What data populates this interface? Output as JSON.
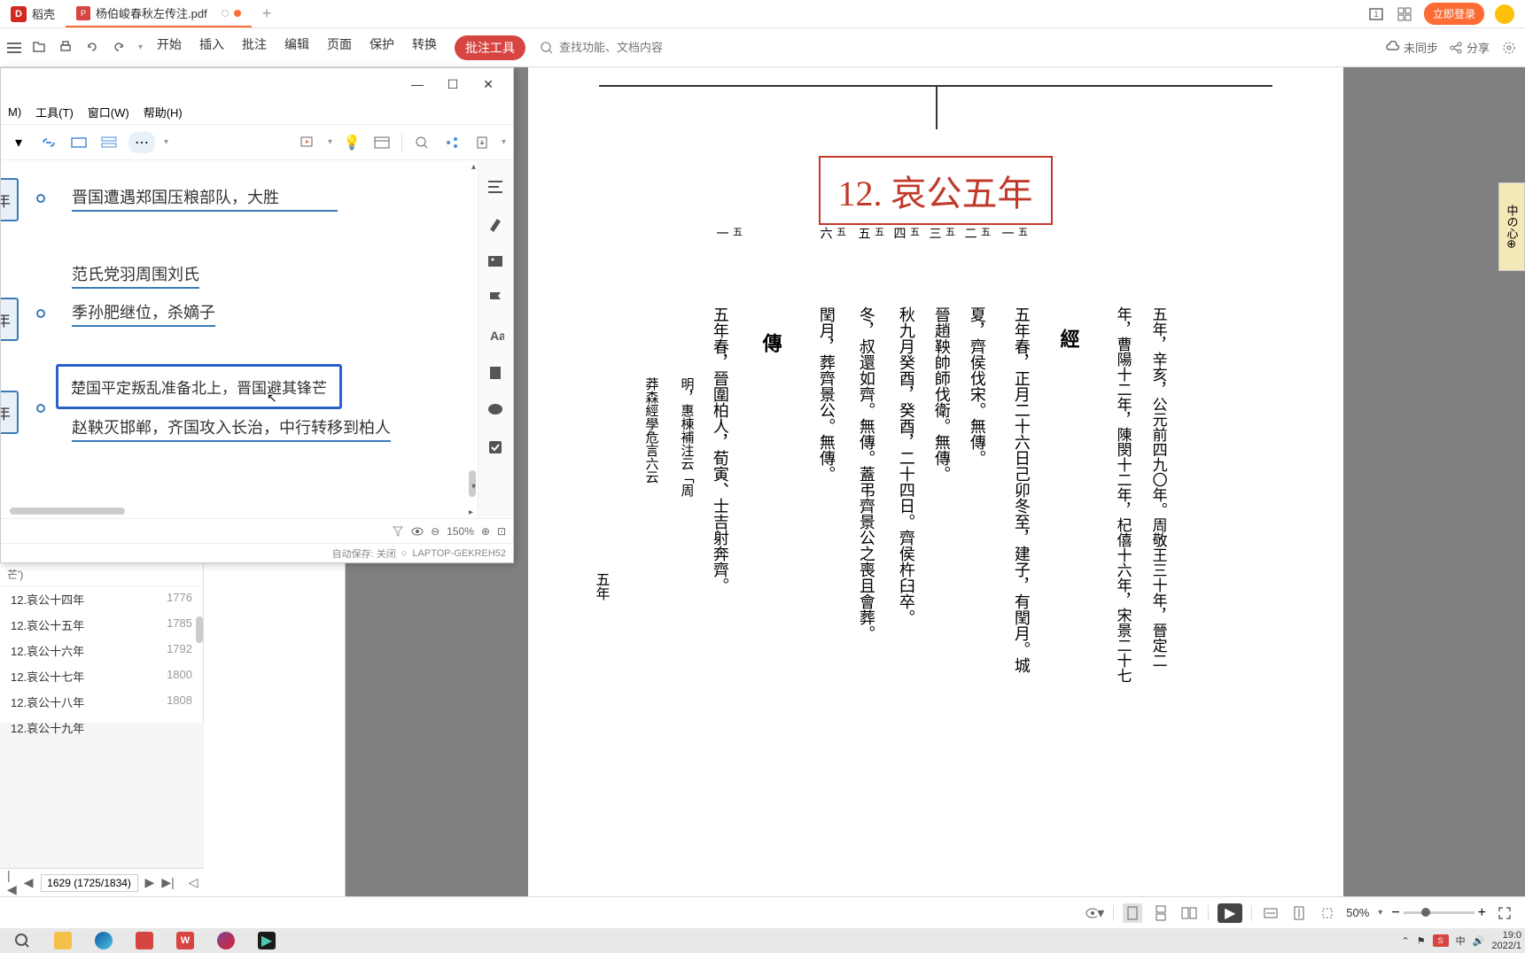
{
  "app": {
    "name": "稻壳",
    "logo_text": "D"
  },
  "tabs": {
    "active": {
      "label": "杨伯峻春秋左传注.pdf",
      "icon": "P"
    },
    "add": "+"
  },
  "login": {
    "label": "立即登录"
  },
  "toolbar": {
    "menu": {
      "start": "开始",
      "insert": "插入",
      "annotate": "批注",
      "edit": "编辑",
      "page": "页面",
      "protect": "保护",
      "convert": "转换",
      "annotation_tools": "批注工具"
    },
    "search_placeholder": "查找功能、文档内容",
    "sync": "未同步",
    "share": "分享"
  },
  "mindmap": {
    "menu": {
      "m": "M)",
      "tools": "工具(T)",
      "window": "窗口(W)",
      "help": "帮助(H)"
    },
    "nodes": {
      "year1": "年",
      "year2": "年",
      "year3": "年",
      "year4": "年",
      "t1": "晋国遭遇郑国压粮部队，大胜",
      "t2": "范氏党羽周围刘氏",
      "t3": "季孙肥继位，杀嫡子",
      "t4": "楚国平定叛乱准备北上，晋国避其锋芒",
      "t5": "赵鞅灭邯郸，齐国攻入长治，中行转移到柏人"
    },
    "zoom": "150%",
    "autosave": "自动保存: 关闭",
    "host": "LAPTOP-GEKREH52"
  },
  "outline": {
    "header": "芒')",
    "items": {
      "i1": {
        "label": "12.哀公十四年",
        "page": "1776"
      },
      "i2": {
        "label": "12.哀公十五年",
        "page": "1785"
      },
      "i3": {
        "label": "12.哀公十六年",
        "page": "1792"
      },
      "i4": {
        "label": "12.哀公十七年",
        "page": "1800"
      },
      "i5": {
        "label": "12.哀公十八年",
        "page": "1808"
      },
      "i6": {
        "label": "12.哀公十九年",
        "page": ""
      }
    }
  },
  "pdf": {
    "title": "12. 哀公五年",
    "columns": {
      "c1": {
        "top": "五",
        "bot": "一"
      },
      "c2": {
        "top": "五",
        "bot": "二"
      },
      "c3": {
        "top": "五",
        "bot": "三"
      },
      "c4": {
        "top": "五",
        "bot": "四"
      },
      "c5": {
        "top": "五",
        "bot": "五"
      },
      "c6": {
        "top": "五",
        "bot": "六"
      },
      "c7": {
        "top": "五",
        "bot": "一"
      }
    },
    "page_label": "五年",
    "jing": "經",
    "zhuan": "傳",
    "vtext": {
      "v1": "五年，辛亥，公元前四九〇年。周敬王三十年，晉定二",
      "v2": "年，曹陽十二年，陳閔十二年，杞僖十六年，宋景二十七",
      "v3": "五年春，正月二十六日己卯冬至，建子，有閏月。城",
      "v4": "夏，齊侯伐宋。無傳。",
      "v5": "晉趙鞅帥師伐衛。無傳。",
      "v6": "秋九月癸酉，癸酉，二十四日。齊侯杵臼卒。",
      "v7": "冬，叔還如齊。無傳。蓋弔齊景公之喪且會葬。",
      "v8": "閏月，葬齊景公。無傳。",
      "v9": "五年春，晉圍柏人，荀寅、士吉射奔齊。",
      "v10": "明，惠棟補注云﹁周",
      "v11": "莽森經學危言六云"
    },
    "side_tab": "中の心⊕"
  },
  "pagenav": {
    "value": "1629 (1725/1834)"
  },
  "statusbar": {
    "zoom": "50%"
  },
  "taskbar": {
    "time": "19:0",
    "date": "2022/1"
  }
}
